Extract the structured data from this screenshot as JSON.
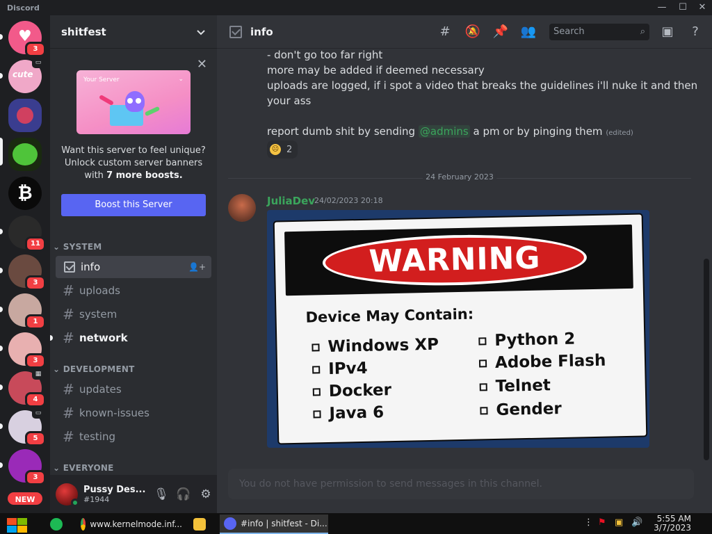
{
  "app": {
    "brand": "Discord"
  },
  "window_controls": {
    "minimize": "—",
    "maximize": "☐",
    "close": "✕"
  },
  "guilds": [
    {
      "badge": "3",
      "color": "#f25a8a"
    },
    {
      "badge": "",
      "color": "#f0a8c8",
      "icon": "monitor"
    },
    {
      "badge": "",
      "color": "#3a3d8f"
    },
    {
      "badge": "",
      "color": "#1a2a10"
    },
    {
      "badge": "",
      "color": "#0a0a0a",
      "glyph": "₿"
    },
    {
      "badge": "11",
      "color": "#2a2a2a"
    },
    {
      "badge": "3",
      "color": "#6a4a40"
    },
    {
      "badge": "1",
      "color": "#c8a8a0"
    },
    {
      "badge": "3",
      "color": "#e8b0b0"
    },
    {
      "badge": "4",
      "color": "#c84a5a"
    },
    {
      "badge": "5",
      "color": "#d8d0e0"
    },
    {
      "badge": "3",
      "color": "#9a2ab8"
    }
  ],
  "new_badge": "NEW",
  "server": {
    "name": "shitfest"
  },
  "boost": {
    "banner_label": "Your Server",
    "line1": "Want this server to feel unique?",
    "line2": "Unlock custom server banners",
    "line3_prefix": "with",
    "line3_bold": "7 more boosts.",
    "button": "Boost this Server"
  },
  "categories": {
    "system": "SYSTEM",
    "development": "DEVELOPMENT",
    "everyone": "EVERYONE"
  },
  "channels": {
    "info": "info",
    "uploads": "uploads",
    "system": "system",
    "network": "network",
    "updates": "updates",
    "known_issues": "known-issues",
    "testing": "testing"
  },
  "user": {
    "name": "Pussy Des...",
    "tag": "#1944"
  },
  "header": {
    "title": "info",
    "search_placeholder": "Search"
  },
  "messages": {
    "line1": "- don't go too far right",
    "line2": "more may be added if deemed necessary",
    "line3": "uploads are logged, if i spot a video that breaks the guidelines i'll nuke it and then",
    "line4": "your ass",
    "line5_prefix": "report dumb shit by sending",
    "line5_mention": "@admins",
    "line5_suffix": "a pm or by pinging them",
    "line5_edited": "(edited)",
    "reaction_count": "2"
  },
  "date_divider": "24 February 2023",
  "post": {
    "author": "JuliaDev",
    "timestamp": "24/02/2023 20:18",
    "image": {
      "headline": "WARNING",
      "subhead": "Device May Contain:",
      "items_left": [
        "Windows XP",
        "IPv4",
        "Docker",
        "Java 6"
      ],
      "items_right": [
        "Python 2",
        "Adobe Flash",
        "Telnet",
        "Gender"
      ]
    }
  },
  "composer_placeholder": "You do not have permission to send messages in this channel.",
  "taskbar": {
    "chrome": "www.kernelmode.inf...",
    "discord": "#info | shitfest - Di...",
    "time": "5:55 AM",
    "date": "3/7/2023"
  }
}
